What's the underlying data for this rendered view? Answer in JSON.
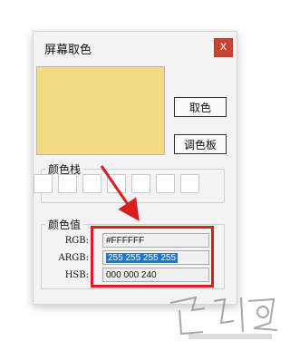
{
  "window": {
    "title": "屏幕取色",
    "close_label": "x"
  },
  "preview": {
    "color": "#F3D982"
  },
  "buttons": {
    "pick": "取色",
    "palette": "调色板"
  },
  "stack": {
    "label": "颜色栈",
    "slots": 7
  },
  "values": {
    "label": "颜色值",
    "rows": [
      {
        "label": "RGB:",
        "value": "#FFFFFF"
      },
      {
        "label": "ARGB:",
        "value": "255 255 255 255",
        "selected": true
      },
      {
        "label": "HSB:",
        "value": "000 000 240"
      }
    ]
  },
  "annotation": {
    "color": "#D71F1F"
  },
  "watermark": {
    "icon": "download-site-logo"
  }
}
